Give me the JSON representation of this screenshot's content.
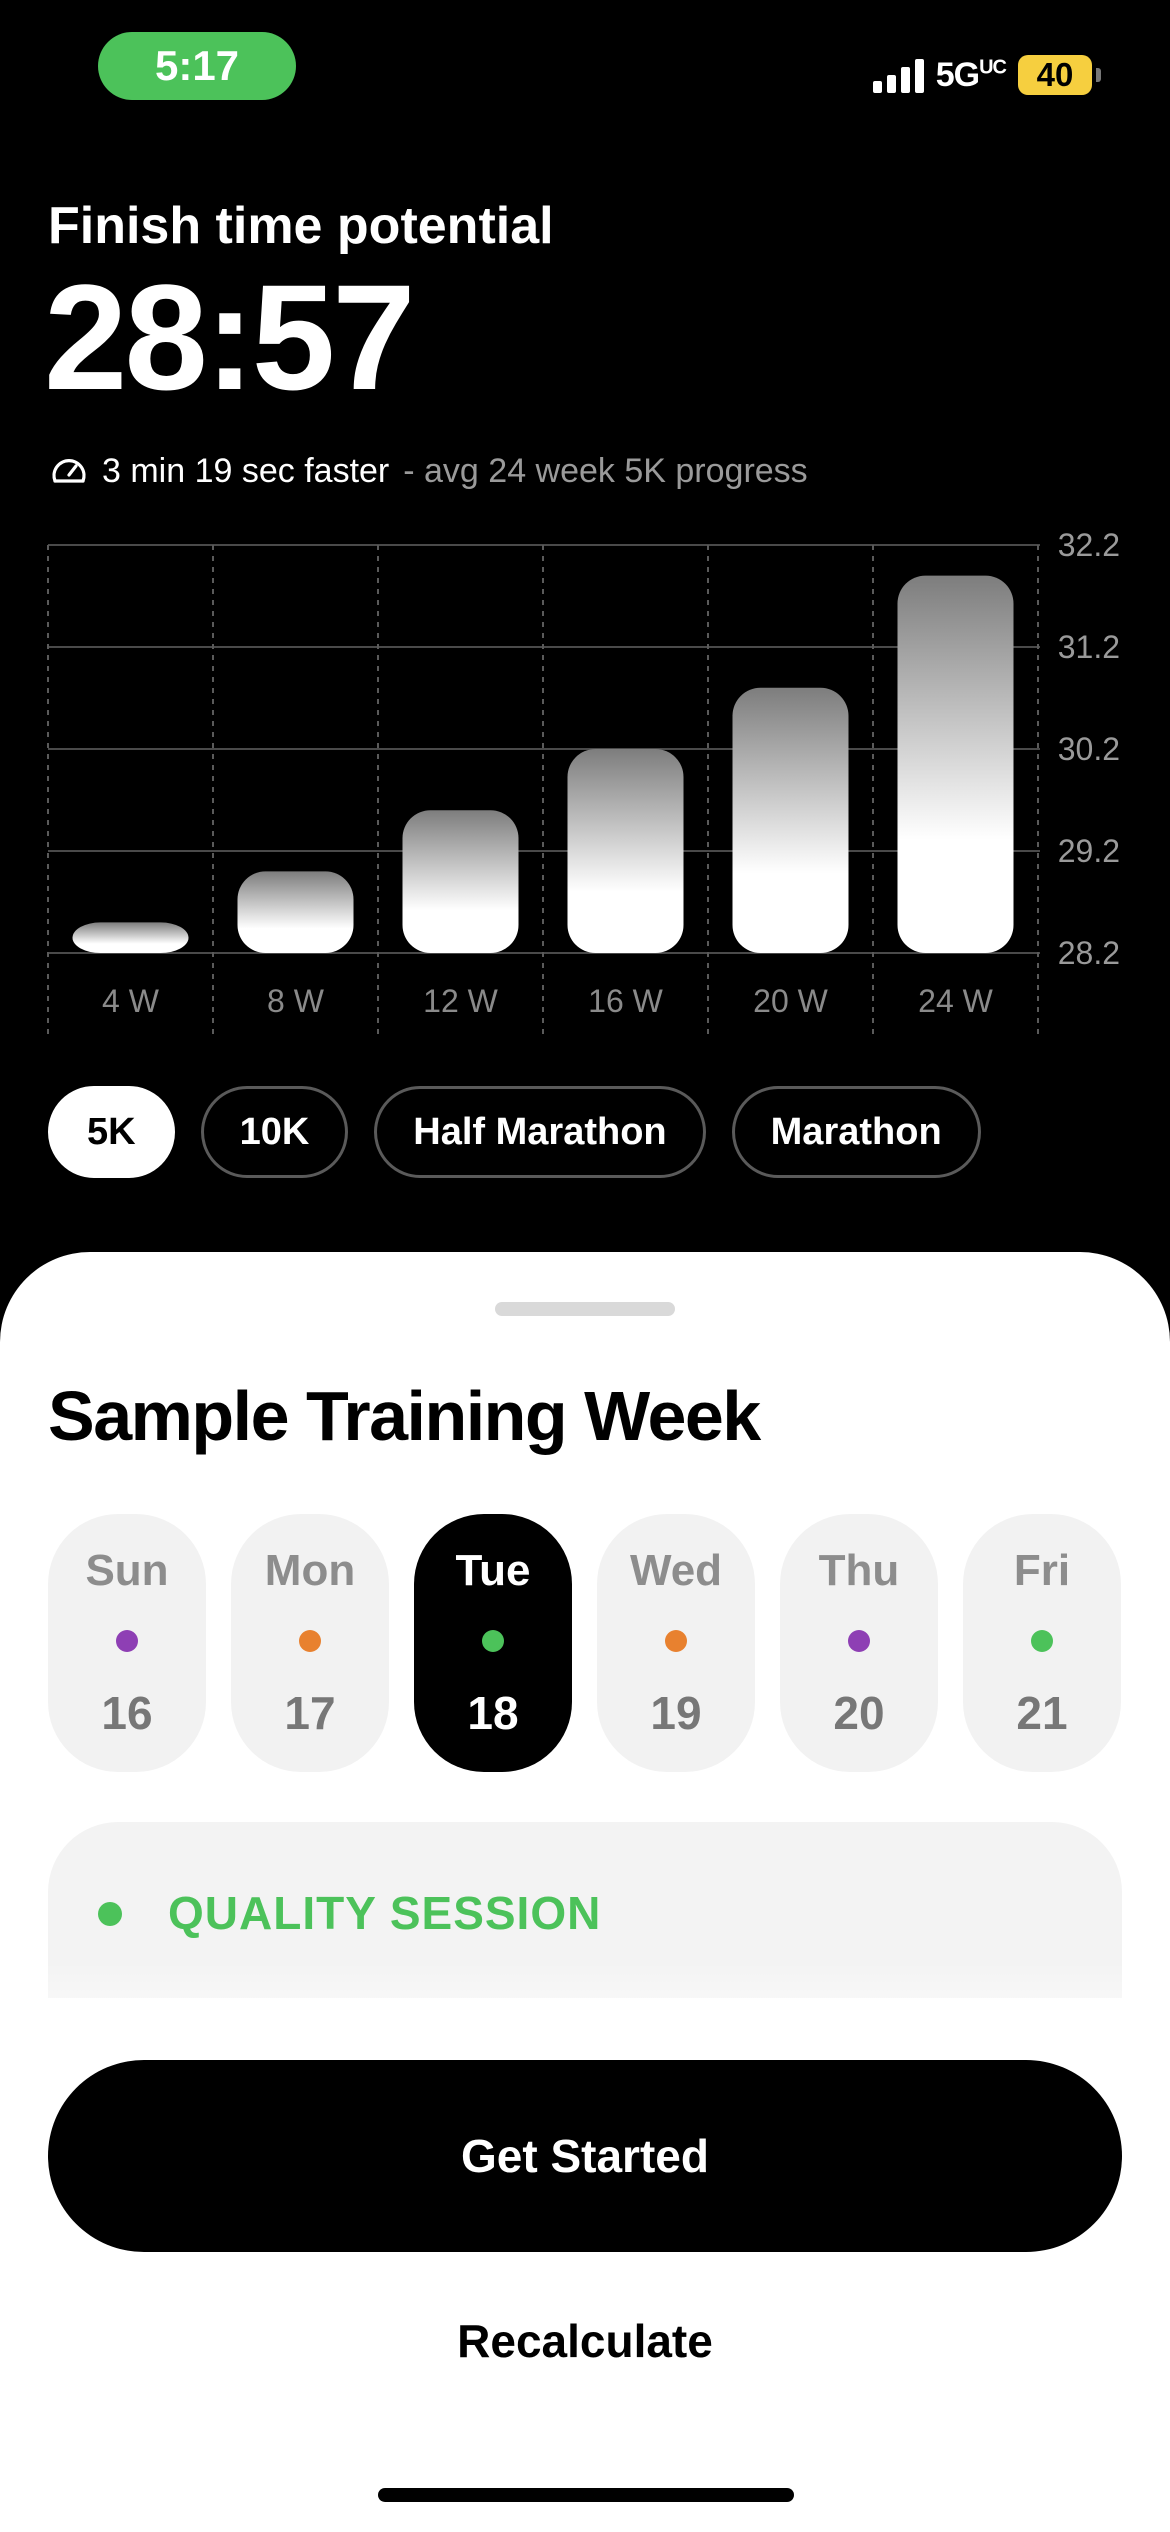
{
  "status": {
    "time": "5:17",
    "network": "5G",
    "network_sup": "UC",
    "battery": "40"
  },
  "header": {
    "subtitle": "Finish time potential",
    "finish_time": "28:57",
    "progress_strong": "3 min 19 sec faster",
    "progress_muted": "- avg 24 week 5K progress",
    "progress_icon": "speedometer-icon"
  },
  "chart_data": {
    "type": "bar",
    "categories": [
      "4 W",
      "8 W",
      "12 W",
      "16 W",
      "20 W",
      "24 W"
    ],
    "values": [
      28.5,
      29.0,
      29.6,
      30.2,
      30.8,
      31.9
    ],
    "y_ticks": [
      "32.2",
      "31.2",
      "30.2",
      "29.2",
      "28.2"
    ],
    "ylim": [
      28.2,
      32.2
    ],
    "grid": true
  },
  "distances": [
    "5K",
    "10K",
    "Half Marathon",
    "Marathon"
  ],
  "selected_distance": "5K",
  "sheet": {
    "title": "Sample Training Week",
    "days": [
      {
        "name": "Sun",
        "num": "16",
        "color": "#8e3fb4",
        "selected": false
      },
      {
        "name": "Mon",
        "num": "17",
        "color": "#e8812f",
        "selected": false
      },
      {
        "name": "Tue",
        "num": "18",
        "color": "#4cc25a",
        "selected": true
      },
      {
        "name": "Wed",
        "num": "19",
        "color": "#e8812f",
        "selected": false
      },
      {
        "name": "Thu",
        "num": "20",
        "color": "#8e3fb4",
        "selected": false
      },
      {
        "name": "Fri",
        "num": "21",
        "color": "#4cc25a",
        "selected": false
      }
    ],
    "session_label": "QUALITY SESSION",
    "session_color": "#4cc25a"
  },
  "footer": {
    "primary_label": "Get Started",
    "secondary_label": "Recalculate"
  }
}
